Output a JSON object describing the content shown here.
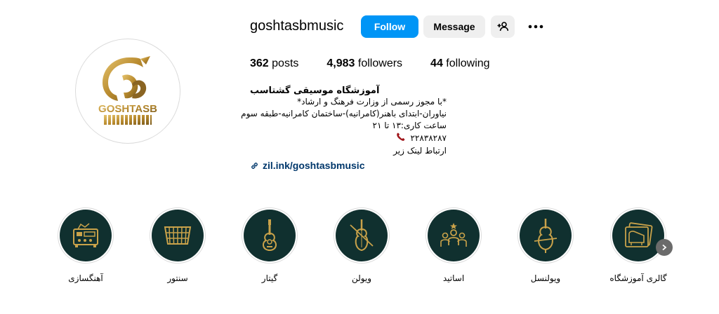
{
  "profile": {
    "username": "goshtasbmusic",
    "follow_label": "Follow",
    "message_label": "Message",
    "logo_text": "GOSHTASB"
  },
  "stats": {
    "posts_count": "362",
    "posts_label": "posts",
    "followers_count": "4,983",
    "followers_label": "followers",
    "following_count": "44",
    "following_label": "following"
  },
  "bio": {
    "name": "آموزشگاه موسیقی گشتاسب",
    "lines": [
      "*با مجوز رسمی از وزارت فرهنگ و ارشاد*",
      "نیاوران-ابتدای باهنر(کامرانیه)-ساختمان کامرانیه-طبقه سوم",
      "ساعت کاری:۱۳ تا ۲۱"
    ],
    "phone": "۲۲۸۳۸۲۸۷",
    "link_note": "ارتباط لینک زیر",
    "link": "zil.ink/goshtasbmusic"
  },
  "highlights": [
    {
      "label": "آهنگسازی",
      "icon": "mixer-icon"
    },
    {
      "label": "سنتور",
      "icon": "santur-icon"
    },
    {
      "label": "گیتار",
      "icon": "guitar-icon"
    },
    {
      "label": "ویولن",
      "icon": "violin-icon"
    },
    {
      "label": "اساتید",
      "icon": "teachers-icon"
    },
    {
      "label": "ویولنسل",
      "icon": "cello-icon"
    },
    {
      "label": "گالری آموزشگاه",
      "icon": "piano-gallery-icon"
    }
  ],
  "colors": {
    "accent": "#0095f6",
    "gold": "#c9a24a",
    "highlight_bg": "#10302f",
    "link": "#00376b"
  }
}
